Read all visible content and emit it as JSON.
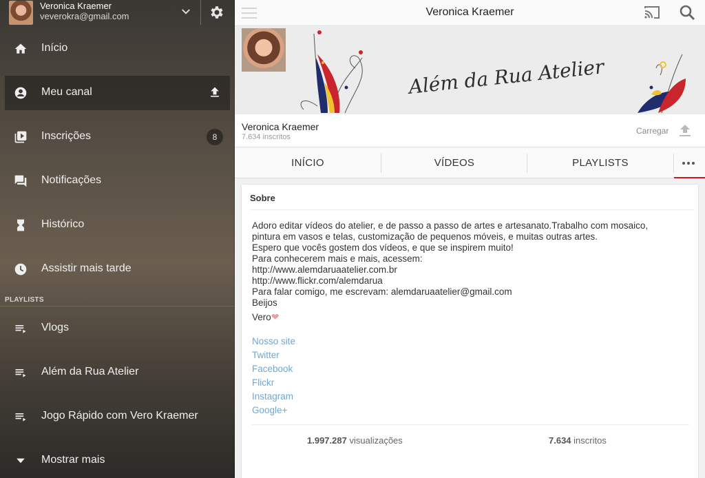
{
  "account": {
    "name": "Veronica Kraemer",
    "email": "veverokra@gmail.com"
  },
  "sidebar": {
    "items": [
      {
        "label": "Início",
        "icon": "home-icon"
      },
      {
        "label": "Meu canal",
        "icon": "account-icon",
        "active": true
      },
      {
        "label": "Inscrições",
        "icon": "subscriptions-icon",
        "badge": "8"
      },
      {
        "label": "Notificações",
        "icon": "notifications-icon"
      },
      {
        "label": "Histórico",
        "icon": "history-icon"
      },
      {
        "label": "Assistir mais tarde",
        "icon": "clock-icon"
      }
    ],
    "playlists_header": "PLAYLISTS",
    "playlists": [
      {
        "label": "Vlogs"
      },
      {
        "label": "Além da Rua Atelier"
      },
      {
        "label": "Jogo Rápido com Vero Kraemer"
      }
    ],
    "show_more": "Mostrar mais"
  },
  "topbar": {
    "title": "Veronica Kraemer"
  },
  "banner": {
    "brand_text": "Além da Rua Atelier"
  },
  "channel": {
    "name": "Veronica Kraemer",
    "subscribers": "7.634 inscritos",
    "upload_label": "Carregar"
  },
  "tabs": [
    "INÍCIO",
    "VÍDEOS",
    "PLAYLISTS"
  ],
  "about": {
    "heading": "Sobre",
    "lines": [
      "Adoro editar vídeos do atelier, e de passo a passo de artes e artesanato.Trabalho com mosaico,",
      "pintura em vasos e telas, customização de pequenos móveis, e muitas outras artes.",
      "Espero que vocês gostem dos vídeos, e que se inspirem muito!",
      "Para conhecerem mais e mais, acessem:",
      "http://www.alemdaruaatelier.com.br",
      "http://www.flickr.com/alemdarua",
      "Para falar comigo, me escrevam: alemdaruaatelier@gmail.com",
      "Beijos"
    ],
    "signoff": "Vero",
    "links": [
      "Nosso site",
      "Twitter",
      "Facebook",
      "Flickr",
      "Instagram",
      "Google+"
    ],
    "views_value": "1.997.287",
    "views_label": "visualizações",
    "subs_value": "7.634",
    "subs_label": "inscritos"
  },
  "colors": {
    "accent": "#cc181e",
    "link": "#6aa9d8"
  }
}
